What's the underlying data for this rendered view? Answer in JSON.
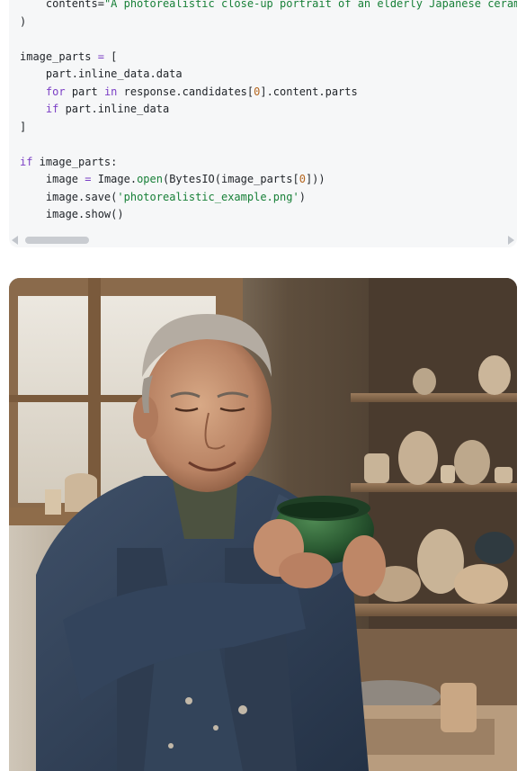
{
  "code": {
    "lines": [
      {
        "indent": 1,
        "tokens": [
          {
            "t": "contents=",
            "c": "plain"
          },
          {
            "t": "\"A photorealistic close-up portrait of an elderly Japanese ceram",
            "c": "str"
          }
        ]
      },
      {
        "indent": 0,
        "tokens": [
          {
            "t": ")",
            "c": "plain"
          }
        ]
      },
      {
        "indent": 0,
        "tokens": []
      },
      {
        "indent": 0,
        "tokens": [
          {
            "t": "image_parts ",
            "c": "plain"
          },
          {
            "t": "=",
            "c": "kw"
          },
          {
            "t": " [",
            "c": "plain"
          }
        ]
      },
      {
        "indent": 1,
        "tokens": [
          {
            "t": "part.inline_data.data",
            "c": "plain"
          }
        ]
      },
      {
        "indent": 1,
        "tokens": [
          {
            "t": "for",
            "c": "kw"
          },
          {
            "t": " part ",
            "c": "plain"
          },
          {
            "t": "in",
            "c": "kw"
          },
          {
            "t": " response.candidates[",
            "c": "plain"
          },
          {
            "t": "0",
            "c": "num"
          },
          {
            "t": "].content.parts",
            "c": "plain"
          }
        ]
      },
      {
        "indent": 1,
        "tokens": [
          {
            "t": "if",
            "c": "kw"
          },
          {
            "t": " part.inline_data",
            "c": "plain"
          }
        ]
      },
      {
        "indent": 0,
        "tokens": [
          {
            "t": "]",
            "c": "plain"
          }
        ]
      },
      {
        "indent": 0,
        "tokens": []
      },
      {
        "indent": 0,
        "tokens": [
          {
            "t": "if",
            "c": "kw"
          },
          {
            "t": " image_parts:",
            "c": "plain"
          }
        ]
      },
      {
        "indent": 1,
        "tokens": [
          {
            "t": "image ",
            "c": "plain"
          },
          {
            "t": "=",
            "c": "kw"
          },
          {
            "t": " Image.",
            "c": "plain"
          },
          {
            "t": "open",
            "c": "fn"
          },
          {
            "t": "(BytesIO(image_parts[",
            "c": "plain"
          },
          {
            "t": "0",
            "c": "num"
          },
          {
            "t": "]))",
            "c": "plain"
          }
        ]
      },
      {
        "indent": 1,
        "tokens": [
          {
            "t": "image.save(",
            "c": "plain"
          },
          {
            "t": "'photorealistic_example.png'",
            "c": "str"
          },
          {
            "t": ")",
            "c": "plain"
          }
        ]
      },
      {
        "indent": 1,
        "tokens": [
          {
            "t": "image.show()",
            "c": "plain"
          }
        ]
      }
    ]
  },
  "scrollbar": {
    "left_arrow_icon": "triangle-left-icon",
    "right_arrow_icon": "triangle-right-icon"
  },
  "colors": {
    "code_bg": "#f6f7f8",
    "keyword": "#7b3fc5",
    "string": "#188038",
    "number": "#b5661f",
    "text": "#1f2328"
  }
}
